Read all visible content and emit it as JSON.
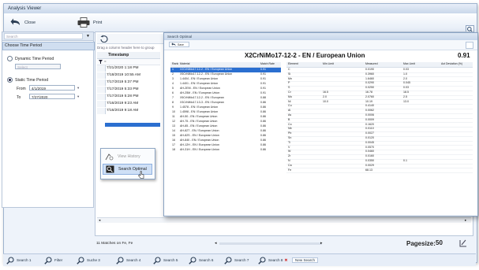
{
  "window": {
    "title": "Analysis Viewer"
  },
  "toolbar": {
    "close_label": "Close",
    "print_label": "Print"
  },
  "left_panel": {
    "search_placeholder": "Search",
    "section_title": "Choose Time Period",
    "dynamic_label": "Dynamic Time Period",
    "dynamic_value": "Select",
    "static_label": "Static Time Period",
    "from_label": "From",
    "from_value": "4/1/2019",
    "to_label": "To",
    "to_value": "7/27/2020"
  },
  "grid": {
    "group_hint": "Drag a column header here to group",
    "column_header": "Timestamp",
    "filter_value": "=",
    "rows": [
      "7/21/2020 1:18 PM",
      "7/18/2019 10:55 AM",
      "7/17/2019 5:37 PM",
      "7/17/2019 5:33 PM",
      "7/17/2019 5:28 PM",
      "7/16/2019 9:23 AM",
      "7/16/2019 9:18 AM"
    ]
  },
  "context_menu": {
    "items": [
      {
        "label": "View History",
        "icon": "history-icon"
      },
      {
        "label": "Search Optimal",
        "icon": "search-optimal-icon"
      }
    ]
  },
  "popup": {
    "title": "Search Optimal",
    "tab_label": "Save",
    "heading": "X2CrNiMo17-12-2 - EN / European Union",
    "score": "0.91",
    "left_headers": [
      "Rank",
      "Material",
      "Match Rate"
    ],
    "right_headers": [
      "Element",
      "Min Limit",
      "Measured",
      "Max Limit",
      "Act Deviation (%)"
    ],
    "left_rows": [
      [
        "1",
        "X2CrNiMo17-12-2 - EN / European Union",
        "0.91"
      ],
      [
        "2",
        "X5CrNiMo17-12-2 - EN / European Union",
        "0.91"
      ],
      [
        "3",
        "1.4404 - EN / European Union",
        "0.91"
      ],
      [
        "4",
        "1.4401 - EN / European Union",
        "0.91"
      ],
      [
        "5",
        "AH-2EM - EN / European Union",
        "0.91"
      ],
      [
        "6",
        "AH-25M - EN / European Union",
        "0.91"
      ],
      [
        "7",
        "X5CrNiMo17-12-2 - EN / European",
        "0.88"
      ],
      [
        "8",
        "X3CrNiMo17-13-3 - EN / European",
        "0.86"
      ],
      [
        "9",
        "1.4578 - EN / European Union",
        "0.86"
      ],
      [
        "10",
        "1.4598 - EN / European Union",
        "0.86"
      ],
      [
        "11",
        "AH-50 - EN / European Union",
        "0.86"
      ],
      [
        "12",
        "AH-75 - EN / European Union",
        "0.86"
      ],
      [
        "13",
        "AH-85 - EN / European Union",
        "0.86"
      ],
      [
        "14",
        "AH-82T - EN / European Union",
        "0.86"
      ],
      [
        "15",
        "AH-82S - EN / European Union",
        "0.86"
      ],
      [
        "16",
        "AH-840 - EN / European Union",
        "0.86"
      ],
      [
        "17",
        "AH-12H - EN / European Union",
        "0.86"
      ],
      [
        "18",
        "AH-31H - EN / European Union",
        "0.86"
      ]
    ],
    "right_rows": [
      [
        "C",
        "",
        "0.0190",
        "0.03",
        ""
      ],
      [
        "Si",
        "",
        "0.3960",
        "1.0",
        ""
      ],
      [
        "Mn",
        "",
        "1.6460",
        "2.0",
        ""
      ],
      [
        "P",
        "",
        "0.0290",
        "0.045",
        ""
      ],
      [
        "S",
        "",
        "0.0250",
        "0.03",
        ""
      ],
      [
        "Cr",
        "16.5",
        "16.78",
        "18.5",
        ""
      ],
      [
        "Mo",
        "2.0",
        "2.0760",
        "2.5",
        ""
      ],
      [
        "Ni",
        "10.0",
        "10.19",
        "13.0",
        ""
      ],
      [
        "Cu",
        "",
        "0.4140",
        "",
        ""
      ],
      [
        "Al",
        "",
        "0.0062",
        "",
        ""
      ],
      [
        "As",
        "",
        "0.0006",
        "",
        ""
      ],
      [
        "B",
        "",
        "0.0009",
        "",
        ""
      ],
      [
        "Co",
        "",
        "0.1620",
        "",
        ""
      ],
      [
        "Nb",
        "",
        "0.0110",
        "",
        ""
      ],
      [
        "Pb",
        "",
        "0.0027",
        "",
        ""
      ],
      [
        "Sn",
        "",
        "0.0120",
        "",
        ""
      ],
      [
        "Ti",
        "",
        "0.0045",
        "",
        ""
      ],
      [
        "V",
        "",
        "0.0570",
        "",
        ""
      ],
      [
        "W",
        "",
        "0.0460",
        "",
        ""
      ],
      [
        "Zr",
        "",
        "0.0160",
        "",
        ""
      ],
      [
        "N",
        "",
        "0.0350",
        "0.1",
        ""
      ],
      [
        "Ca",
        "",
        "0.0029",
        "",
        ""
      ],
      [
        "Fe",
        "",
        "68.13",
        "",
        ""
      ]
    ]
  },
  "bottom": {
    "matches_text": "11 Matches on Fe, Fe",
    "pagesize_label": "Pagesize:",
    "pagesize_value": "50"
  },
  "tabs": [
    {
      "label": "Search 1"
    },
    {
      "label": "Filter"
    },
    {
      "label": "Suche 3"
    },
    {
      "label": "Search 4"
    },
    {
      "label": "Search 5"
    },
    {
      "label": "Search 6"
    },
    {
      "label": "Search 7"
    },
    {
      "label": "Search 8"
    },
    {
      "label": "New Search"
    }
  ],
  "colors": {
    "selection": "#2b6fd0",
    "accent": "#3a7bd5",
    "menu_highlight": "#cfe0f6",
    "close_tab": "#d33a3a"
  }
}
